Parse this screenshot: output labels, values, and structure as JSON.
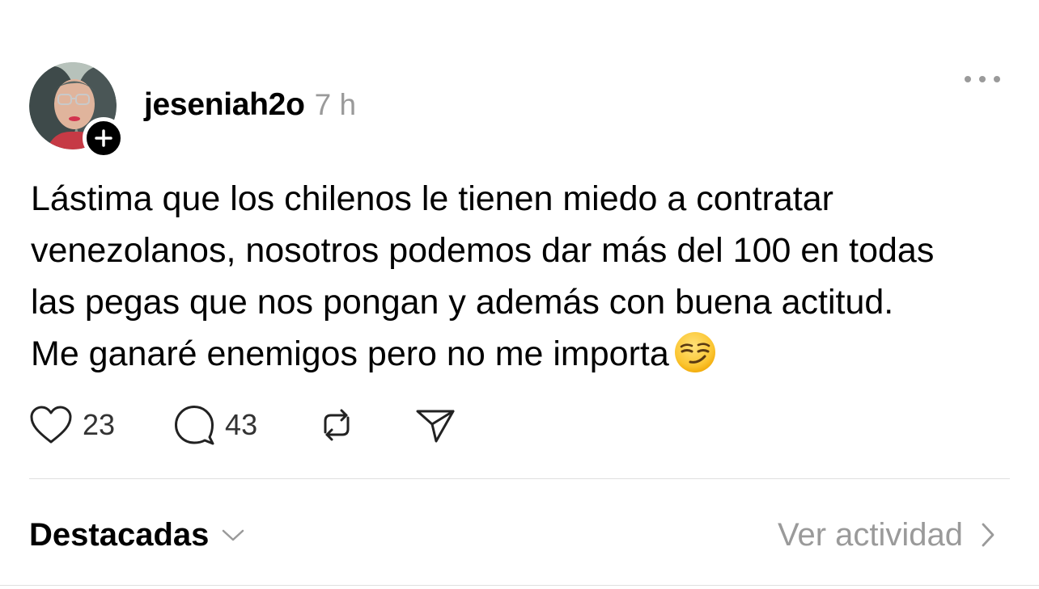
{
  "post": {
    "author": {
      "username": "jeseniah2o",
      "avatar_icon": "profile-photo",
      "follow_icon": "plus-icon"
    },
    "timestamp": "7 h",
    "more_icon": "more-horizontal-icon",
    "text_lines": [
      "Lástima que los chilenos le tienen miedo a contratar",
      "venezolanos, nosotros podemos dar más del 100 en todas",
      "las pegas que nos pongan y además con buena actitud.",
      "Me ganaré enemigos pero no me importa"
    ],
    "emoji": "smirking-face",
    "actions": {
      "like_count": "23",
      "reply_count": "43",
      "like_icon": "heart-icon",
      "reply_icon": "comment-icon",
      "repost_icon": "repost-icon",
      "share_icon": "send-icon"
    }
  },
  "footer": {
    "featured_label": "Destacadas",
    "activity_label": "Ver actividad"
  },
  "colors": {
    "text": "#000000",
    "muted": "#9a9a9a",
    "divider": "#e0e0e0"
  }
}
